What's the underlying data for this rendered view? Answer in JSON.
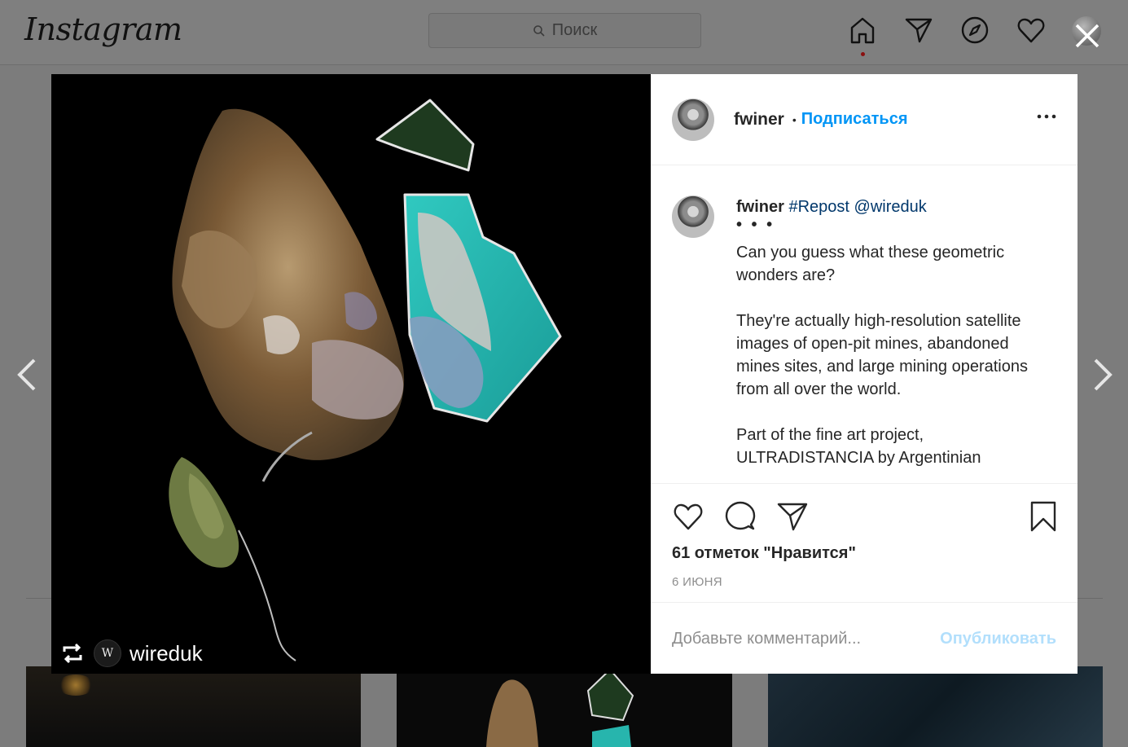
{
  "header": {
    "logo": "Instagram",
    "search_placeholder": "Поиск"
  },
  "post": {
    "username": "fwiner",
    "separator": "•",
    "follow_label": "Подписаться",
    "repost_label": "wireduk",
    "repost_logo": "W",
    "caption": {
      "username": "fwiner",
      "hashtag": "#Repost",
      "mention": "@wireduk",
      "ellipsis": "• • •",
      "paragraph1": "Can you guess what these geometric wonders are?",
      "paragraph2": "They're actually high-resolution satellite images of open-pit mines, abandoned mines sites, and large mining operations from all over the world.",
      "paragraph3": "Part of the fine art project, ULTRADISTANCIA by Argentinian"
    },
    "likes": "61 отметок \"Нравится\"",
    "date": "6 ИЮНЯ",
    "comment_placeholder": "Добавьте комментарий...",
    "publish_label": "Опубликовать"
  },
  "icons": {
    "home": "home-icon",
    "direct": "direct-icon",
    "explore": "explore-icon",
    "activity": "heart-icon",
    "close": "close-icon",
    "prev": "chevron-left-icon",
    "next": "chevron-right-icon"
  },
  "colors": {
    "link_blue": "#0095f6",
    "hashtag": "#00376b",
    "publish_disabled": "#b2dffc",
    "overlay_bg": "#7c7c7c"
  }
}
